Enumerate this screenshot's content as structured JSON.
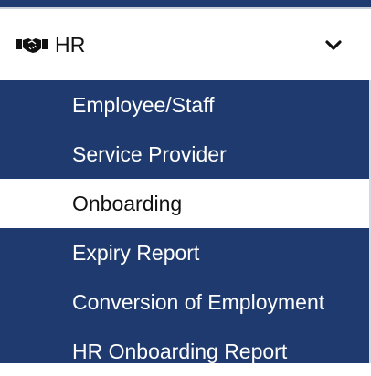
{
  "menu": {
    "section": {
      "label": "HR",
      "icon": "handshake-icon",
      "toggle_icon": "chevron-down-icon",
      "expanded": true
    },
    "items": [
      {
        "label": "Employee/Staff",
        "active": false
      },
      {
        "label": "Service Provider",
        "active": false
      },
      {
        "label": "Onboarding",
        "active": true
      },
      {
        "label": "Expiry Report",
        "active": false
      },
      {
        "label": "Conversion of Employment",
        "active": false
      },
      {
        "label": "HR Onboarding Report",
        "active": false
      }
    ]
  },
  "colors": {
    "sidebar_bg": "#1e3a6e",
    "active_bg": "#ffffff",
    "text_light": "#ffffff",
    "text_dark": "#111111"
  }
}
